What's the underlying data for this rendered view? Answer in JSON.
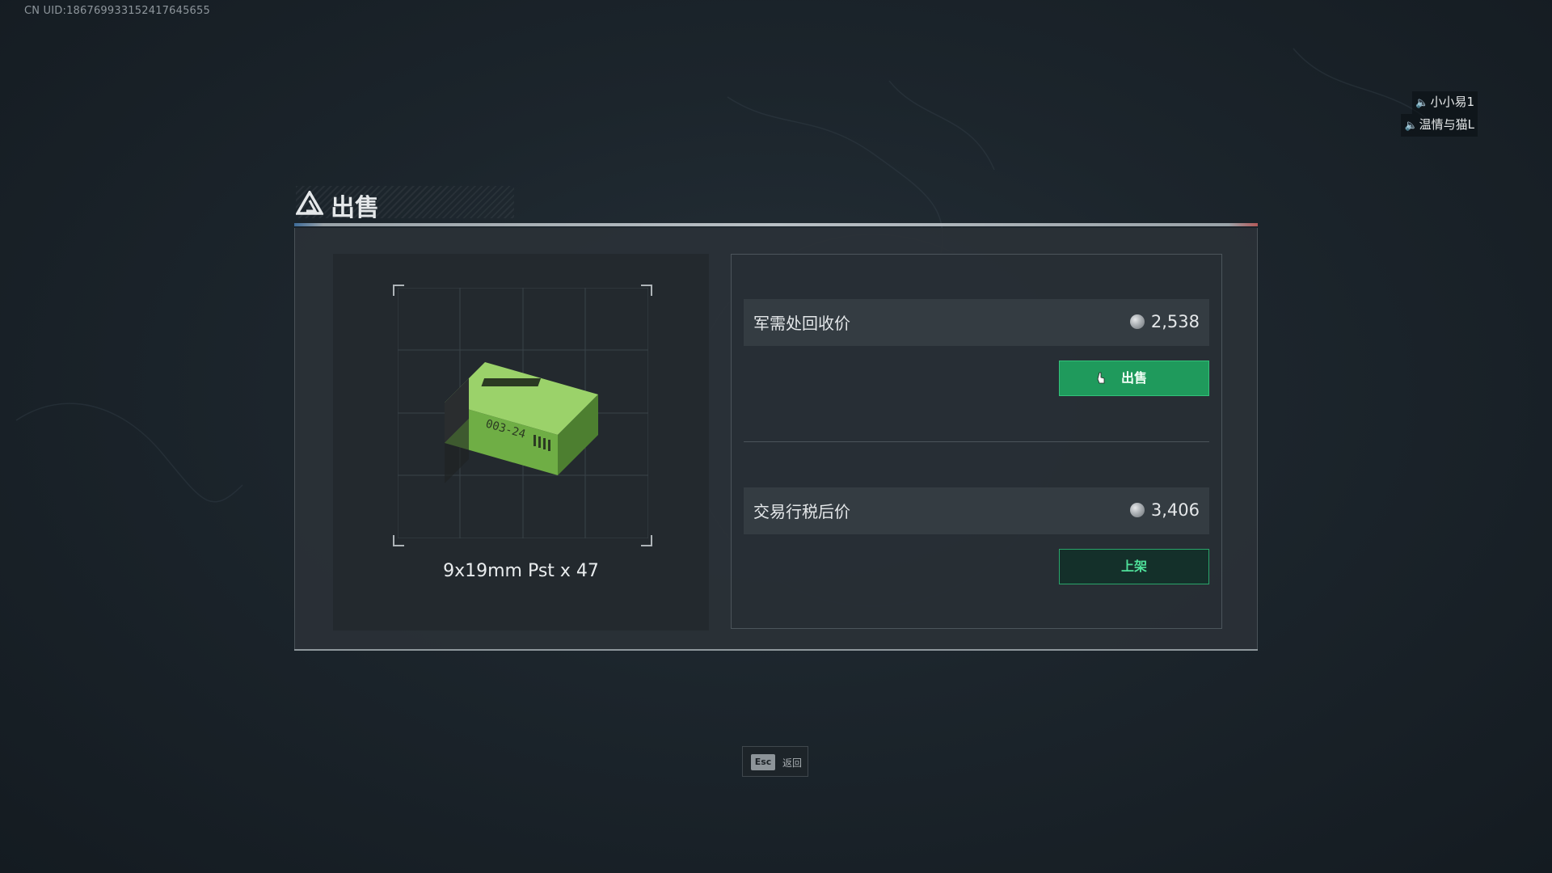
{
  "header": {
    "uid_text": "CN UID:186769933152417645655"
  },
  "voice": {
    "speakers": [
      "小小易1",
      "温情与猫L"
    ]
  },
  "dialog": {
    "title": "出售",
    "item": {
      "name": "9x19mm Pst x 47",
      "icon": "ammo-box-icon"
    },
    "quartermaster": {
      "label": "军需处回收价",
      "price": "2,538",
      "button_label": "出售"
    },
    "exchange": {
      "label": "交易行税后价",
      "price": "3,406",
      "button_label": "上架"
    }
  },
  "footer": {
    "esc_key": "Esc",
    "esc_label": "返回"
  },
  "colors": {
    "accent_green": "#1f9a5c",
    "text_green": "#4fe09a",
    "panel": "#2a3137"
  }
}
